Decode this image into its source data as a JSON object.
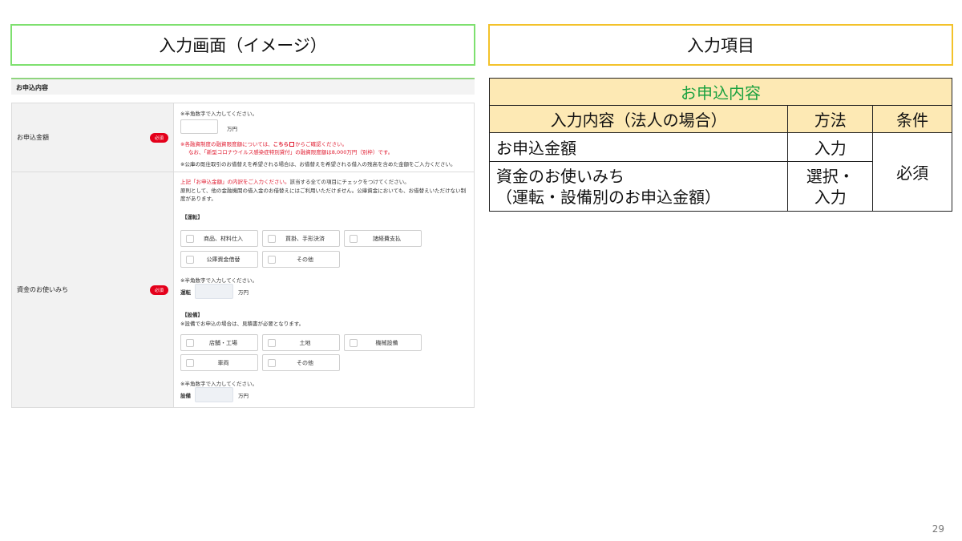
{
  "headers": {
    "left": "入力画面（イメージ）",
    "right": "入力項目"
  },
  "form": {
    "section_title": "お申込内容",
    "required_badge": "必須",
    "amount": {
      "label": "お申込金額",
      "hint": "※半角数字で入力してください。",
      "unit": "万円",
      "note1_pre": "※各融資制度の融資限度額については、",
      "note1_link": "こちら",
      "note1_post": "からご確認ください。",
      "note2": "なお、「新型コロナウイルス感染症特別貸付」の融資限度額は8,000万円（別枠）です。",
      "note3": "※公庫の既往取引のお借替えを希望される場合は、お借替えを希望される借入の残高を含めた金額をご入力ください。"
    },
    "usage": {
      "label": "資金のお使いみち",
      "intro_red": "上記「お申込金額」の内訳をご入力ください。",
      "intro_rest": "該当する全ての項目にチェックをつけてください。",
      "intro2": "原則として、他の金融機関の借入金のお借替えにはご利用いただけません。公庫資金においても、お借替えいただけない制",
      "intro3": "度があります。",
      "operating_head": "【運転】",
      "operating_options": [
        "商品、材料仕入",
        "買掛、手形決済",
        "諸経費支払",
        "公庫資金借替",
        "その他"
      ],
      "hint": "※半角数字で入力してください。",
      "operating_label": "運転",
      "unit": "万円",
      "equipment_head": "【設備】",
      "equipment_note": "※設備でお申込の場合は、見積書が必要となります。",
      "equipment_options": [
        "店舗・工場",
        "土地",
        "機械設備",
        "車両",
        "その他"
      ],
      "equipment_label": "設備"
    }
  },
  "spec_table": {
    "title": "お申込内容",
    "columns": [
      "入力内容（法人の場合）",
      "方法",
      "条件"
    ],
    "rows": [
      {
        "item": "お申込金額",
        "method": "入力"
      },
      {
        "item_line1": "資金のお使いみち",
        "item_line2": "（運転・設備別のお申込金額）",
        "method_line1": "選択・",
        "method_line2": "入力"
      }
    ],
    "condition": "必須"
  },
  "page_number": "29",
  "colors": {
    "left_border": "#7ee06f",
    "right_border": "#f3c22a",
    "table_header_bg": "#fde9b4",
    "table_title_text": "#1aa13f",
    "badge_red": "#e4001b"
  }
}
